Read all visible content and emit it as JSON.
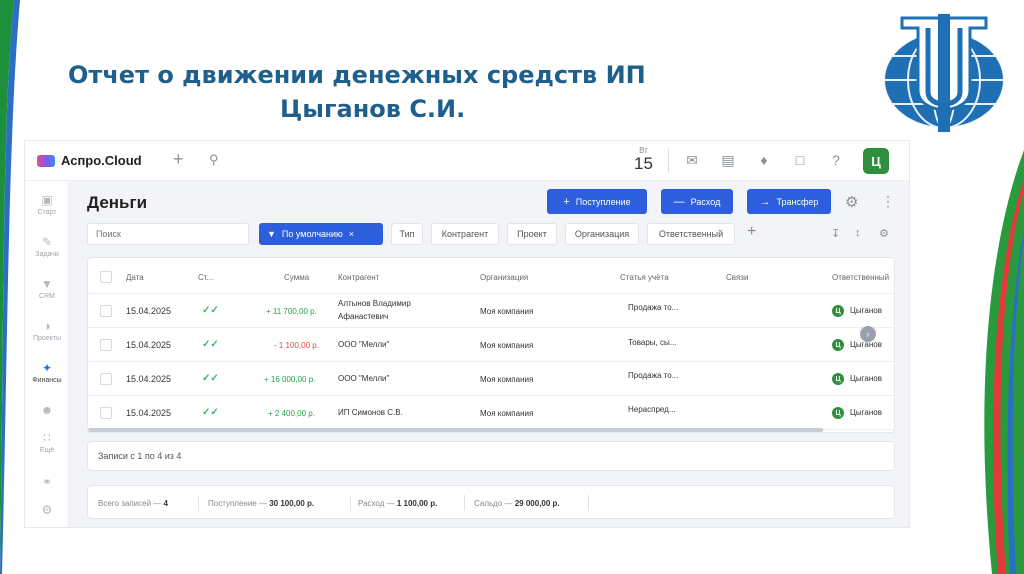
{
  "slide": {
    "title_line1": "Отчет о движении денежных средств ИП",
    "title_line2": "Цыганов С.И."
  },
  "colors": {
    "accent": "#2d5fdc",
    "positive": "#27a14b",
    "negative": "#e0493c",
    "avatar": "#2f8f3e",
    "slide_title": "#1f5f8b"
  },
  "app": {
    "brand": "Аспро.Cloud",
    "date_dow": "Вт",
    "date_day": "15",
    "user_initial": "Ц",
    "nav": [
      {
        "label": "Старт",
        "icon": "start-icon"
      },
      {
        "label": "Задачи",
        "icon": "tasks-icon"
      },
      {
        "label": "CRM",
        "icon": "crm-icon"
      },
      {
        "label": "Проекты",
        "icon": "projects-icon"
      },
      {
        "label": "Финансы",
        "icon": "finance-icon"
      },
      {
        "label": "",
        "icon": "users-icon"
      },
      {
        "label": "Ещё",
        "icon": "more-icon"
      },
      {
        "label": "",
        "icon": "help-icon"
      },
      {
        "label": "",
        "icon": "settings-icon"
      }
    ],
    "page_title": "Деньги",
    "buttons": {
      "income": "Поступление",
      "expense": "Расход",
      "transfer": "Трансфер"
    },
    "filters": {
      "search_placeholder": "Поиск",
      "preset": "По умолчанию",
      "chips": [
        "Тип",
        "Контрагент",
        "Проект",
        "Организация",
        "Ответственный"
      ]
    },
    "table": {
      "headers": {
        "date": "Дата",
        "status": "Ст...",
        "amount": "Сумма",
        "counterparty": "Контрагент",
        "organization": "Организация",
        "article": "Статья учёта",
        "links": "Связи",
        "responsible": "Ответственный"
      },
      "rows": [
        {
          "date": "15.04.2025",
          "amount": "+ 11 700,00 р.",
          "sign": "pos",
          "counterparty_l1": "Алтынов Владимир",
          "counterparty_l2": "Афанастевич",
          "organization": "Моя компания",
          "article": "Продажа то...",
          "responsible": "Цыганов"
        },
        {
          "date": "15.04.2025",
          "amount": "- 1 100,00 р.",
          "sign": "neg",
          "counterparty_l1": "ООО \"Мелли\"",
          "counterparty_l2": "",
          "organization": "Моя компания",
          "article": "Товары, сы...",
          "responsible": "Цыганов"
        },
        {
          "date": "15.04.2025",
          "amount": "+ 16 000,00 р.",
          "sign": "pos",
          "counterparty_l1": "ООО \"Мелли\"",
          "counterparty_l2": "",
          "organization": "Моя компания",
          "article": "Продажа то...",
          "responsible": "Цыганов"
        },
        {
          "date": "15.04.2025",
          "amount": "+ 2 400,00 р.",
          "sign": "pos",
          "counterparty_l1": "ИП Симонов С.В.",
          "counterparty_l2": "",
          "organization": "Моя компания",
          "article": "Нераспред...",
          "responsible": "Цыганов"
        }
      ]
    },
    "paging": "Записи с 1 по 4 из 4",
    "summary": {
      "total_label": "Всего записей —",
      "total_value": "4",
      "income_label": "Поступление —",
      "income_value": "30 100,00 р.",
      "expense_label": "Расход —",
      "expense_value": "1 100,00 р.",
      "balance_label": "Сальдо —",
      "balance_value": "29 000,00 р."
    }
  }
}
